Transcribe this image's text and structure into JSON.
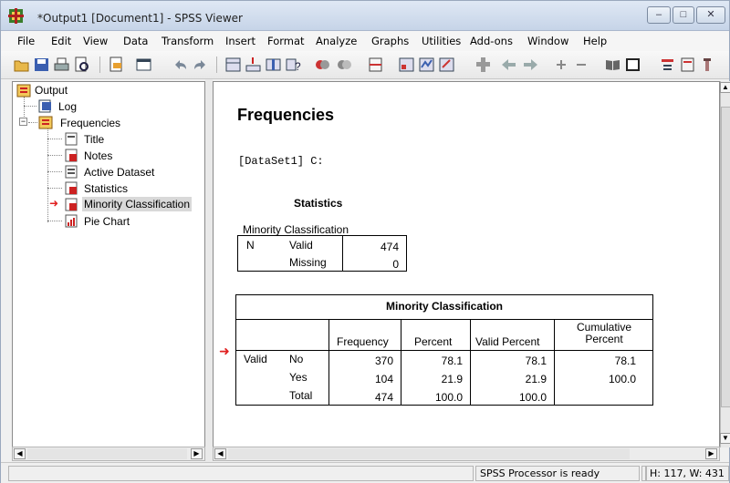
{
  "window": {
    "title": "*Output1 [Document1] - SPSS Viewer",
    "controls": [
      "minimize-icon",
      "maximize-icon",
      "close-icon"
    ]
  },
  "menubar": {
    "items": [
      "File",
      "Edit",
      "View",
      "Data",
      "Transform",
      "Insert",
      "Format",
      "Analyze",
      "Graphs",
      "Utilities",
      "Add-ons",
      "Window",
      "Help"
    ]
  },
  "toolbar": {
    "icons": [
      "open-icon",
      "save-icon",
      "print-icon",
      "print-preview-icon",
      "export-icon",
      "recall-dialog-icon",
      "undo-icon",
      "redo-icon",
      "goto-data-icon",
      "goto-case-icon",
      "variables-icon",
      "find-icon",
      "use-sets-icon",
      "show-all-variables-icon",
      "split-file-icon",
      "weight-cases-icon",
      "select-cases-icon",
      "value-labels-icon",
      "promote-icon",
      "back-icon",
      "forward-icon",
      "expand-icon",
      "collapse-icon",
      "show-icon",
      "hide-icon",
      "insert-heading-icon",
      "insert-title-icon",
      "insert-text-icon"
    ]
  },
  "outline": {
    "root": "Output",
    "log": "Log",
    "group": "Frequencies",
    "children": [
      "Title",
      "Notes",
      "Active Dataset",
      "Statistics",
      "Minority Classification",
      "Pie Chart"
    ],
    "selected": "Minority Classification"
  },
  "content": {
    "heading": "Frequencies",
    "dataset": "[DataSet1] C:",
    "statistics": {
      "title": "Statistics",
      "variable": "Minority Classification",
      "rows": [
        {
          "label": "N",
          "sublabel": "Valid",
          "value": "474"
        },
        {
          "label": "",
          "sublabel": "Missing",
          "value": "0"
        }
      ]
    },
    "frequency_table": {
      "title": "Minority Classification",
      "columns": [
        "Frequency",
        "Percent",
        "Valid Percent",
        "Cumulative Percent"
      ],
      "group_label": "Valid",
      "rows": [
        {
          "label": "No",
          "frequency": "370",
          "percent": "78.1",
          "valid_percent": "78.1",
          "cumulative": "78.1"
        },
        {
          "label": "Yes",
          "frequency": "104",
          "percent": "21.9",
          "valid_percent": "21.9",
          "cumulative": "100.0"
        },
        {
          "label": "Total",
          "frequency": "474",
          "percent": "100.0",
          "valid_percent": "100.0",
          "cumulative": ""
        }
      ]
    }
  },
  "status": {
    "processor": "SPSS  Processor is ready",
    "dimensions": "H: 117, W: 431 pt"
  },
  "colors": {
    "accent_red": "#e02020",
    "title_gradient_top": "#dfe8f4",
    "title_gradient_bottom": "#c6d4e8"
  }
}
